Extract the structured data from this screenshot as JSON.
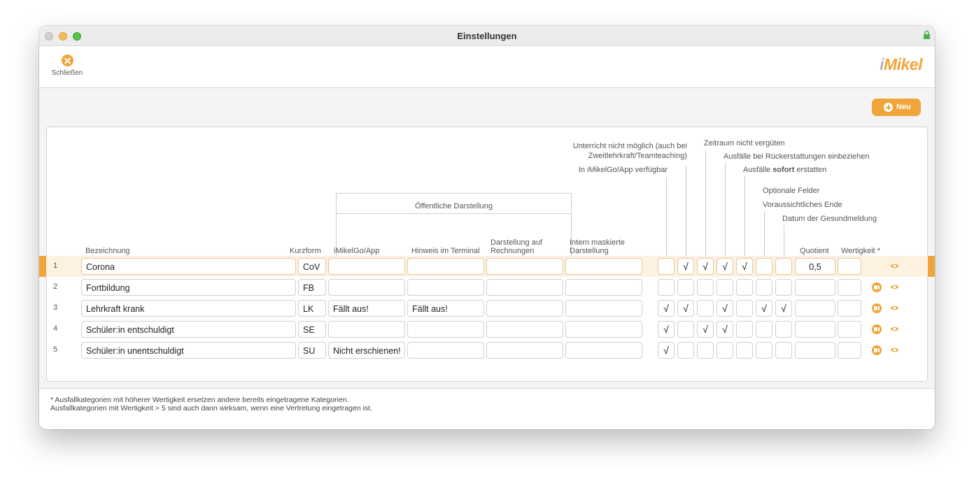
{
  "window": {
    "title": "Einstellungen"
  },
  "toolbar": {
    "close_label": "Schließen",
    "logo_i": "i",
    "logo_rest": "Mikel"
  },
  "new_button": {
    "label": "Neu"
  },
  "headers": {
    "bezeichnung": "Bezeichnung",
    "kurzform": "Kurzform",
    "group_label": "Öffentliche Darstellung",
    "imikelgo": "iMikelGo/App",
    "hinweis": "Hinweis im Terminal",
    "darstellung_line1": "Darstellung auf",
    "darstellung_line2": "Rechnungen",
    "intern_line1": "Intern maskierte",
    "intern_line2": "Darstellung",
    "unterricht_line1": "Unterricht nicht möglich (auch bei",
    "unterricht_line2": "Zweitlehrkraft/Teamteaching)",
    "imikelgo_verfuegbar": "In iMikelGo/App verfügbar",
    "zeitraum": "Zeitraum nicht vergüten",
    "rueckerstattungen": "Ausfälle bei Rückerstattungen einbeziehen",
    "sofort_pre": "Ausfälle ",
    "sofort_bold": "sofort",
    "sofort_post": " erstatten",
    "optionale": "Optionale Felder",
    "voraussichtlich": "Voraussichtliches Ende",
    "gesundmeldung": "Datum der Gesundmeldung",
    "quotient": "Quotient",
    "wertigkeit": "Wertigkeit *"
  },
  "rows": [
    {
      "num": "1",
      "name": "Corona",
      "short": "CoV",
      "imikelgo": "",
      "hinweis": "",
      "rechnung": "",
      "intern": "",
      "c1": "",
      "c2": "√",
      "c3": "√",
      "c4": "√",
      "c5": "√",
      "c6": "",
      "c7": "",
      "quotient": "0,5",
      "wertigkeit": ""
    },
    {
      "num": "2",
      "name": "Fortbildung",
      "short": "FB",
      "imikelgo": "",
      "hinweis": "",
      "rechnung": "",
      "intern": "",
      "c1": "",
      "c2": "",
      "c3": "",
      "c4": "",
      "c5": "",
      "c6": "",
      "c7": "",
      "quotient": "",
      "wertigkeit": ""
    },
    {
      "num": "3",
      "name": "Lehrkraft krank",
      "short": "LK",
      "imikelgo": "Fällt aus!",
      "hinweis": "Fällt aus!",
      "rechnung": "",
      "intern": "",
      "c1": "√",
      "c2": "√",
      "c3": "",
      "c4": "√",
      "c5": "",
      "c6": "√",
      "c7": "√",
      "quotient": "",
      "wertigkeit": ""
    },
    {
      "num": "4",
      "name": "Schüler:in entschuldigt",
      "short": "SE",
      "imikelgo": "",
      "hinweis": "",
      "rechnung": "",
      "intern": "",
      "c1": "√",
      "c2": "",
      "c3": "√",
      "c4": "√",
      "c5": "",
      "c6": "",
      "c7": "",
      "quotient": "",
      "wertigkeit": ""
    },
    {
      "num": "5",
      "name": "Schüler:in unentschuldigt",
      "short": "SU",
      "imikelgo": "Nicht erschienen!",
      "hinweis": "",
      "rechnung": "",
      "intern": "",
      "c1": "√",
      "c2": "",
      "c3": "",
      "c4": "",
      "c5": "",
      "c6": "",
      "c7": "",
      "quotient": "",
      "wertigkeit": ""
    }
  ],
  "footer": {
    "line1": "* Ausfallkategorien mit höherer Wertigkeit ersetzen andere bereits eingetragene Kategorien.",
    "line2": "Ausfallkategorien mit Wertigkeit > 5 sind auch dann wirksam, wenn eine Vertretung eingetragen ist."
  },
  "colors": {
    "accent": "#f0a53a",
    "selected_row": "#fdf1e2"
  }
}
